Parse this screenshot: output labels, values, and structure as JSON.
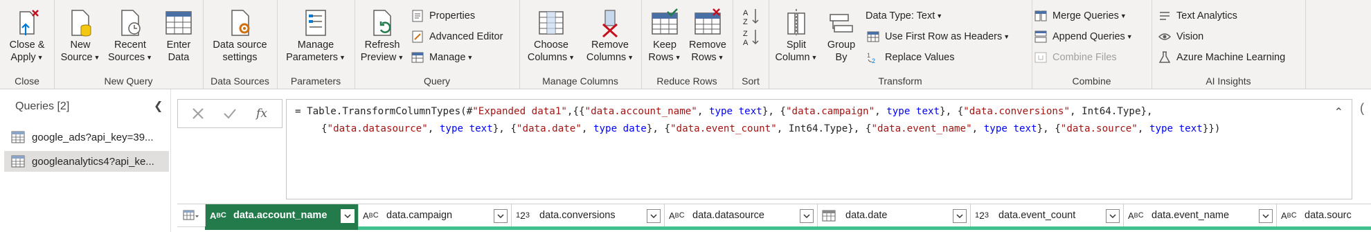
{
  "ribbon": {
    "groups": {
      "close": "Close",
      "new_query": "New Query",
      "data_sources": "Data Sources",
      "parameters": "Parameters",
      "query": "Query",
      "manage_columns": "Manage Columns",
      "reduce_rows": "Reduce Rows",
      "sort": "Sort",
      "transform": "Transform",
      "combine": "Combine",
      "ai_insights": "AI Insights"
    },
    "close_apply": [
      "Close &",
      "Apply"
    ],
    "new_source": [
      "New",
      "Source"
    ],
    "recent_sources": [
      "Recent",
      "Sources"
    ],
    "enter_data": [
      "Enter",
      "Data"
    ],
    "data_source_settings": [
      "Data source",
      "settings"
    ],
    "manage_parameters": [
      "Manage",
      "Parameters"
    ],
    "refresh_preview": [
      "Refresh",
      "Preview"
    ],
    "properties": "Properties",
    "advanced_editor": "Advanced Editor",
    "manage": "Manage",
    "choose_columns": [
      "Choose",
      "Columns"
    ],
    "remove_columns": [
      "Remove",
      "Columns"
    ],
    "keep_rows": [
      "Keep",
      "Rows"
    ],
    "remove_rows": [
      "Remove",
      "Rows"
    ],
    "split_column": [
      "Split",
      "Column"
    ],
    "group_by": [
      "Group",
      "By"
    ],
    "data_type": "Data Type: Text",
    "use_first_row": "Use First Row as Headers",
    "replace_values": "Replace Values",
    "merge_queries": "Merge Queries",
    "append_queries": "Append Queries",
    "combine_files": "Combine Files",
    "text_analytics": "Text Analytics",
    "vision": "Vision",
    "azure_ml": "Azure Machine Learning"
  },
  "queries_pane": {
    "title": "Queries [2]",
    "items": [
      {
        "label": "google_ads?api_key=39..."
      },
      {
        "label": "googleanalytics4?api_ke..."
      }
    ]
  },
  "formula": {
    "fx": "fx",
    "line1": [
      {
        "t": "= Table.TransformColumnTypes(#",
        "c": ""
      },
      {
        "t": "\"Expanded data1\"",
        "c": "str"
      },
      {
        "t": ",{{",
        "c": ""
      },
      {
        "t": "\"data.account_name\"",
        "c": "str"
      },
      {
        "t": ", ",
        "c": ""
      },
      {
        "t": "type text",
        "c": "kw"
      },
      {
        "t": "}, {",
        "c": ""
      },
      {
        "t": "\"data.campaign\"",
        "c": "str"
      },
      {
        "t": ", ",
        "c": ""
      },
      {
        "t": "type text",
        "c": "kw"
      },
      {
        "t": "}, {",
        "c": ""
      },
      {
        "t": "\"data.conversions\"",
        "c": "str"
      },
      {
        "t": ", Int64.Type},",
        "c": ""
      }
    ],
    "line2": [
      {
        "t": "{",
        "c": ""
      },
      {
        "t": "\"data.datasource\"",
        "c": "str"
      },
      {
        "t": ", ",
        "c": ""
      },
      {
        "t": "type text",
        "c": "kw"
      },
      {
        "t": "}, {",
        "c": ""
      },
      {
        "t": "\"data.date\"",
        "c": "str"
      },
      {
        "t": ", ",
        "c": ""
      },
      {
        "t": "type date",
        "c": "kw"
      },
      {
        "t": "}, {",
        "c": ""
      },
      {
        "t": "\"data.event_count\"",
        "c": "str"
      },
      {
        "t": ", Int64.Type}, {",
        "c": ""
      },
      {
        "t": "\"data.event_name\"",
        "c": "str"
      },
      {
        "t": ", ",
        "c": ""
      },
      {
        "t": "type text",
        "c": "kw"
      },
      {
        "t": "}, {",
        "c": ""
      },
      {
        "t": "\"data.source\"",
        "c": "str"
      },
      {
        "t": ", ",
        "c": ""
      },
      {
        "t": "type text",
        "c": "kw"
      },
      {
        "t": "}})",
        "c": ""
      }
    ]
  },
  "columns": [
    {
      "name": "data.account_name",
      "type": "ABC"
    },
    {
      "name": "data.campaign",
      "type": "ABC"
    },
    {
      "name": "data.conversions",
      "type": "123"
    },
    {
      "name": "data.datasource",
      "type": "ABC"
    },
    {
      "name": "data.date",
      "type": "date"
    },
    {
      "name": "data.event_count",
      "type": "123"
    },
    {
      "name": "data.event_name",
      "type": "ABC"
    },
    {
      "name": "data.sourc",
      "type": "ABC"
    }
  ],
  "colors": {
    "active_header": "#237b4b",
    "quality_bar": "#3fc08d",
    "string_literal": "#a31515",
    "keyword": "#0000ff"
  }
}
